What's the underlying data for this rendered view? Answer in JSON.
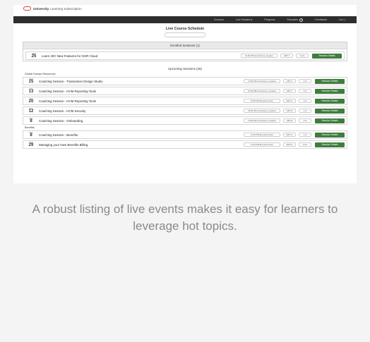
{
  "brand": {
    "name": "University",
    "subtitle": "Learning Subscription"
  },
  "nav": [
    {
      "label": "Courses"
    },
    {
      "label": "Live Sessions"
    },
    {
      "label": "Progress"
    },
    {
      "label": "Favorites",
      "badge": "0"
    },
    {
      "label": "Feedback"
    },
    {
      "label": "Lex | ↓"
    }
  ],
  "page": {
    "title": "Live Course Schedule",
    "search_placeholder": ""
  },
  "enrolled": {
    "header": "Enrolled Sessions (1)",
    "rows": [
      {
        "month": "Aug",
        "day": "25",
        "title": "Learn 20C New Features for GHR Cloud",
        "location": "01:00 PM America/Los_Angeles",
        "gmt": "GMT-7",
        "duration": "2 Hrs",
        "button": "Session Details"
      }
    ]
  },
  "upcoming": {
    "header": "Upcoming Sessions (25)",
    "groups": [
      {
        "name": "Global Human Resources",
        "rows": [
          {
            "month": "Sep",
            "day": "15",
            "title": "Coaching Session - Transaction Design Studio",
            "location": "10:00 AM America/Los_Angeles",
            "gmt": "GMT-7",
            "duration": "1 Hr",
            "button": "Session Details"
          },
          {
            "month": "Oct",
            "day": "13",
            "title": "Coaching Session - HCM Reporting Tools",
            "location": "01:00 PM America/Los_Angeles",
            "gmt": "GMT-7",
            "duration": "1 Hr",
            "button": "Session Details"
          },
          {
            "month": "Oct",
            "day": "20",
            "title": "Coaching Session - HCM Reporting Tools",
            "location": "10:00 AM Europe/London",
            "gmt": "GMT+1",
            "duration": "1 Hr",
            "button": "Session Details"
          },
          {
            "month": "Nov",
            "day": "12",
            "title": "Coaching Session - HCM Security",
            "location": "09:00 AM America/Los_Angeles",
            "gmt": "GMT-8",
            "duration": "1 Hr",
            "button": "Session Details"
          },
          {
            "month": "Dec",
            "day": "8",
            "title": "Coaching Session - Onboarding",
            "location": "10:00 AM America/Los_Angeles",
            "gmt": "GMT-8",
            "duration": "1 Hr",
            "button": "Session Details"
          }
        ]
      },
      {
        "name": "Benefits",
        "rows": [
          {
            "month": "Sep",
            "day": "8",
            "title": "Coaching Session - Benefits",
            "location": "12:00 PM Europe/London",
            "gmt": "GMT+1",
            "duration": "1 Hr",
            "button": "Session Details"
          },
          {
            "month": "Sep",
            "day": "29",
            "title": "Managing your Own Benefits Billing",
            "location": "12:00 PM Europe/London",
            "gmt": "GMT+1",
            "duration": "2 Hrs",
            "button": "Session Details"
          }
        ]
      }
    ]
  },
  "caption": "A robust listing of live events makes it easy for learners to leverage hot topics.",
  "colors": {
    "accent_button": "#3f7d3e",
    "nav_bg": "#2e2e2e",
    "logo": "#c74634",
    "caption_text": "#8a8a8a"
  }
}
